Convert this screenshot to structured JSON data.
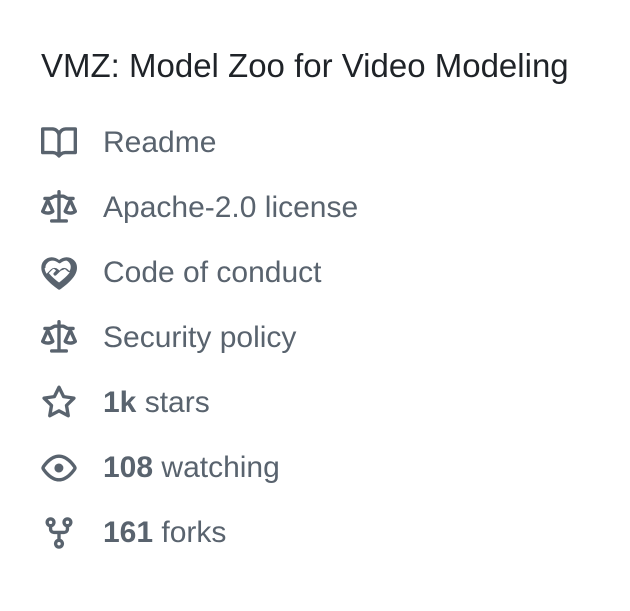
{
  "about": {
    "description": "VMZ: Model Zoo for Video Modeling"
  },
  "links": [
    {
      "icon": "book-icon",
      "label": "Readme"
    },
    {
      "icon": "law-icon",
      "label": "Apache-2.0 license"
    },
    {
      "icon": "code-of-conduct-icon",
      "label": "Code of conduct"
    },
    {
      "icon": "law-icon",
      "label": "Security policy"
    }
  ],
  "stats": [
    {
      "icon": "star-icon",
      "count": "1k",
      "label": " stars"
    },
    {
      "icon": "eye-icon",
      "count": "108",
      "label": " watching"
    },
    {
      "icon": "repo-forked-icon",
      "count": "161",
      "label": " forks"
    }
  ]
}
